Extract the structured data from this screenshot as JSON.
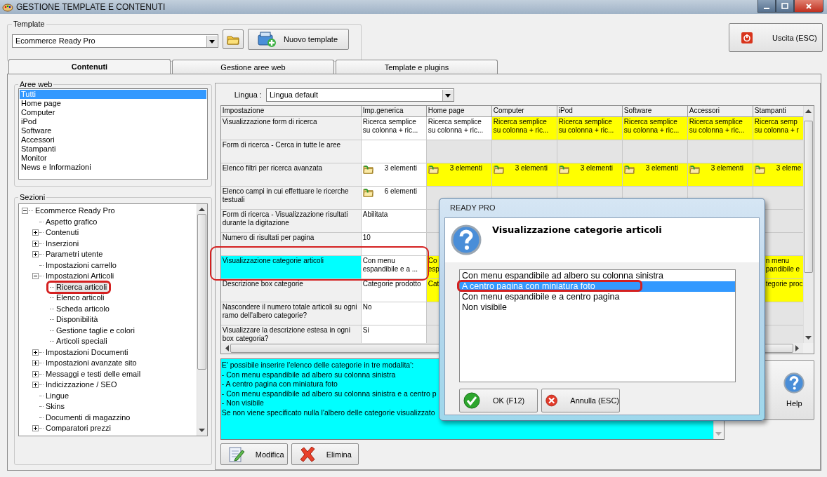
{
  "window": {
    "title": "GESTIONE TEMPLATE E CONTENUTI"
  },
  "template": {
    "label": "Template",
    "value": "Ecommerce Ready Pro",
    "new_button": "Nuovo template"
  },
  "exit_button": "Uscita (ESC)",
  "tabs": [
    {
      "label": "Contenuti",
      "selected": true
    },
    {
      "label": "Gestione aree web",
      "selected": false
    },
    {
      "label": "Template e plugins",
      "selected": false
    }
  ],
  "web_areas": {
    "label": "Aree web",
    "items": [
      {
        "label": "Tutti",
        "selected": true
      },
      {
        "label": "Home page",
        "selected": false
      },
      {
        "label": "Computer",
        "selected": false
      },
      {
        "label": "iPod",
        "selected": false
      },
      {
        "label": "Software",
        "selected": false
      },
      {
        "label": "Accessori",
        "selected": false
      },
      {
        "label": "Stampanti",
        "selected": false
      },
      {
        "label": "Monitor",
        "selected": false
      },
      {
        "label": "News e Informazioni",
        "selected": false
      }
    ]
  },
  "sections": {
    "label": "Sezioni",
    "tree": [
      {
        "label": "Ecommerce Ready Pro",
        "kind": "branch",
        "expanded": true,
        "selected": false,
        "children": [
          {
            "label": "Aspetto grafico",
            "kind": "leaf",
            "selected": false
          },
          {
            "label": "Contenuti",
            "kind": "branch",
            "expanded": false,
            "selected": false
          },
          {
            "label": "Inserzioni",
            "kind": "branch",
            "expanded": false,
            "selected": false
          },
          {
            "label": "Parametri utente",
            "kind": "branch",
            "expanded": false,
            "selected": false
          },
          {
            "label": "Impostazioni carrello",
            "kind": "leaf",
            "selected": false
          },
          {
            "label": "Impostazioni Articoli",
            "kind": "branch",
            "expanded": true,
            "selected": false,
            "children": [
              {
                "label": "Ricerca articoli",
                "kind": "leaf",
                "selected": true
              },
              {
                "label": "Elenco articoli",
                "kind": "leaf",
                "selected": false
              },
              {
                "label": "Scheda articolo",
                "kind": "leaf",
                "selected": false
              },
              {
                "label": "Disponibilità",
                "kind": "leaf",
                "selected": false
              },
              {
                "label": "Gestione taglie e colori",
                "kind": "leaf",
                "selected": false
              },
              {
                "label": "Articoli speciali",
                "kind": "leaf",
                "selected": false
              }
            ]
          },
          {
            "label": "Impostazioni Documenti",
            "kind": "branch",
            "expanded": false,
            "selected": false
          },
          {
            "label": "Impostazioni avanzate sito",
            "kind": "branch",
            "expanded": false,
            "selected": false
          },
          {
            "label": "Messaggi e testi delle email",
            "kind": "branch",
            "expanded": false,
            "selected": false
          },
          {
            "label": "Indicizzazione / SEO",
            "kind": "branch",
            "expanded": false,
            "selected": false
          },
          {
            "label": "Lingue",
            "kind": "leaf",
            "selected": false
          },
          {
            "label": "Skins",
            "kind": "leaf",
            "selected": false
          },
          {
            "label": "Documenti di magazzino",
            "kind": "leaf",
            "selected": false
          },
          {
            "label": "Comparatori prezzi",
            "kind": "branch",
            "expanded": false,
            "selected": false
          }
        ]
      }
    ]
  },
  "language": {
    "label": "Lingua :",
    "value": "Lingua default"
  },
  "grid": {
    "columns": [
      "Impostazione",
      "Imp.generica",
      "Home page",
      "Computer",
      "iPod",
      "Software",
      "Accessori",
      "Stampanti"
    ],
    "rows": [
      {
        "selected": false,
        "cells": [
          {
            "text": "Visualizzazione form di ricerca"
          },
          {
            "kind": "text",
            "overridden": false,
            "inherited": false,
            "text": "Ricerca semplice\nsu colonna + ric..."
          },
          {
            "kind": "text",
            "overridden": false,
            "inherited": false,
            "text": "Ricerca semplice\nsu colonna + ric..."
          },
          {
            "kind": "text",
            "overridden": true,
            "text": "Ricerca semplice\nsu colonna + ric..."
          },
          {
            "kind": "text",
            "overridden": true,
            "text": "Ricerca semplice\nsu colonna + ric..."
          },
          {
            "kind": "text",
            "overridden": true,
            "text": "Ricerca semplice\nsu colonna + ric..."
          },
          {
            "kind": "text",
            "overridden": true,
            "text": "Ricerca semplice\nsu colonna + ric..."
          },
          {
            "kind": "text",
            "overridden": true,
            "text": "Ricerca semp\nsu colonna + r"
          }
        ]
      },
      {
        "selected": false,
        "cells": [
          {
            "text": "Form di ricerca - Cerca in tutte le aree"
          },
          {
            "kind": "text",
            "overridden": false,
            "inherited": false
          },
          {
            "kind": "text",
            "overridden": false,
            "inherited": true
          },
          {
            "kind": "text",
            "overridden": false,
            "inherited": true
          },
          {
            "kind": "text",
            "overridden": false,
            "inherited": true
          },
          {
            "kind": "text",
            "overridden": false,
            "inherited": true
          },
          {
            "kind": "text",
            "overridden": false,
            "inherited": true
          },
          {
            "kind": "text",
            "overridden": false,
            "inherited": true
          }
        ]
      },
      {
        "selected": false,
        "cells": [
          {
            "text": "Elenco filtri per ricerca avanzata"
          },
          {
            "kind": "list",
            "overridden": false,
            "inherited": false,
            "text": "3 elementi"
          },
          {
            "kind": "list",
            "overridden": true,
            "text": "3 elementi"
          },
          {
            "kind": "list",
            "overridden": true,
            "text": "3 elementi"
          },
          {
            "kind": "list",
            "overridden": true,
            "text": "3 elementi"
          },
          {
            "kind": "list",
            "overridden": true,
            "text": "3 elementi"
          },
          {
            "kind": "list",
            "overridden": true,
            "text": "3 elementi"
          },
          {
            "kind": "list",
            "overridden": true,
            "text": "3 eleme"
          }
        ]
      },
      {
        "selected": false,
        "cells": [
          {
            "text": "Elenco campi in cui effettuare le ricerche testuali"
          },
          {
            "kind": "list",
            "overridden": false,
            "inherited": false,
            "text": "6 elementi"
          },
          {
            "kind": "text",
            "overridden": false,
            "inherited": true
          },
          {
            "kind": "text",
            "overridden": false,
            "inherited": true
          },
          {
            "kind": "text",
            "overridden": false,
            "inherited": true
          },
          {
            "kind": "text",
            "overridden": false,
            "inherited": true
          },
          {
            "kind": "text",
            "overridden": false,
            "inherited": true
          },
          {
            "kind": "text",
            "overridden": false,
            "inherited": true
          }
        ]
      },
      {
        "selected": false,
        "cells": [
          {
            "text": "Form di ricerca - Visualizzazione risultati durante la digitazione"
          },
          {
            "kind": "text",
            "overridden": false,
            "inherited": false,
            "text": "Abilitata"
          },
          {
            "kind": "text",
            "overridden": false,
            "inherited": true
          },
          {},
          {},
          {},
          {},
          {
            "kind": "text",
            "overridden": false,
            "inherited": true
          }
        ]
      },
      {
        "selected": false,
        "cells": [
          {
            "text": "Numero di risultati per pagina"
          },
          {
            "kind": "text",
            "overridden": false,
            "inherited": false,
            "text": "10"
          },
          {
            "kind": "text",
            "overridden": false,
            "inherited": true
          },
          {},
          {},
          {},
          {},
          {
            "kind": "text",
            "overridden": false,
            "inherited": true
          }
        ]
      },
      {
        "selected": true,
        "cells": [
          {
            "text": "Visualizzazione categorie articoli"
          },
          {
            "kind": "text",
            "overridden": false,
            "inherited": false,
            "text": "Con menu\nespandibile e a ..."
          },
          {
            "kind": "text",
            "overridden": true,
            "text": "Co\nesp"
          },
          {},
          {},
          {},
          {},
          {
            "kind": "partial",
            "overridden": true,
            "text": "n menu\npandibile e"
          }
        ]
      },
      {
        "selected": false,
        "cells": [
          {
            "text": "Descrizione box categorie"
          },
          {
            "kind": "text",
            "overridden": false,
            "inherited": false,
            "text": "Categorie prodotto"
          },
          {
            "kind": "text",
            "overridden": true,
            "text": "Cat"
          },
          {},
          {},
          {},
          {},
          {
            "kind": "partial",
            "overridden": true,
            "text": "tegorie proc"
          }
        ]
      },
      {
        "selected": false,
        "cells": [
          {
            "text": "Nascondere il numero totale articoli su ogni ramo dell'albero categorie?"
          },
          {
            "kind": "text",
            "overridden": false,
            "inherited": false,
            "text": "No"
          },
          {
            "kind": "text",
            "overridden": false,
            "inherited": true
          },
          {},
          {},
          {},
          {},
          {
            "kind": "text",
            "overridden": false,
            "inherited": true
          }
        ]
      },
      {
        "selected": false,
        "cells": [
          {
            "text": "Visualizzare la descrizione estesa in ogni box categoria?"
          },
          {
            "kind": "text",
            "overridden": false,
            "inherited": false,
            "text": "Si"
          },
          {
            "kind": "text",
            "overridden": false,
            "inherited": true
          },
          {},
          {},
          {},
          {},
          {
            "kind": "text",
            "overridden": false,
            "inherited": true
          }
        ]
      }
    ]
  },
  "description": {
    "lines": [
      "E' possibile inserire l'elenco delle categorie in tre modalita':",
      "- Con menu espandibile ad albero su colonna sinistra",
      "- A centro pagina con miniatura foto",
      "- Con menu espandibile ad albero su colonna sinistra e a centro p",
      "- Non visibile",
      "Se non viene specificato nulla l'albero delle categorie visualizzato"
    ]
  },
  "buttons": [
    {
      "label": "Modifica",
      "kind": "edit"
    },
    {
      "label": "Elimina",
      "kind": "delete"
    }
  ],
  "help_button": "Help",
  "dialog": {
    "title": "READY PRO",
    "heading": "Visualizzazione categorie articoli",
    "options": [
      {
        "label": "Con menu espandibile ad albero su colonna sinistra",
        "selected": false
      },
      {
        "label": "A centro pagina con miniatura foto",
        "selected": true
      },
      {
        "label": "Con menu espandibile e a centro pagina",
        "selected": false
      },
      {
        "label": "Non visibile",
        "selected": false
      }
    ],
    "buttons": [
      {
        "label": "OK (F12)",
        "kind": "ok"
      },
      {
        "label": "Annulla (ESC)",
        "kind": "cancel"
      }
    ]
  }
}
